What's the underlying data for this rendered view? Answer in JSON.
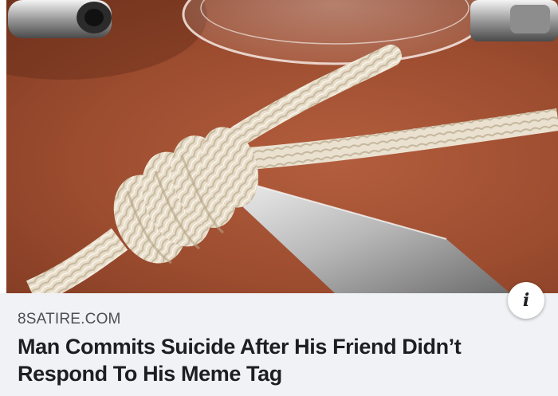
{
  "link_preview": {
    "domain": "8SATIRE.COM",
    "headline": "Man Commits Suicide After His Friend Didn’t Respond To His Meme Tag"
  },
  "info_button": {
    "icon": "info-icon",
    "glyph": "i"
  },
  "colors": {
    "caption_background": "#f0f2f5",
    "domain_text": "#4b4f56",
    "headline_text": "#1c1e21",
    "table_surface": "#9c4c2f"
  }
}
